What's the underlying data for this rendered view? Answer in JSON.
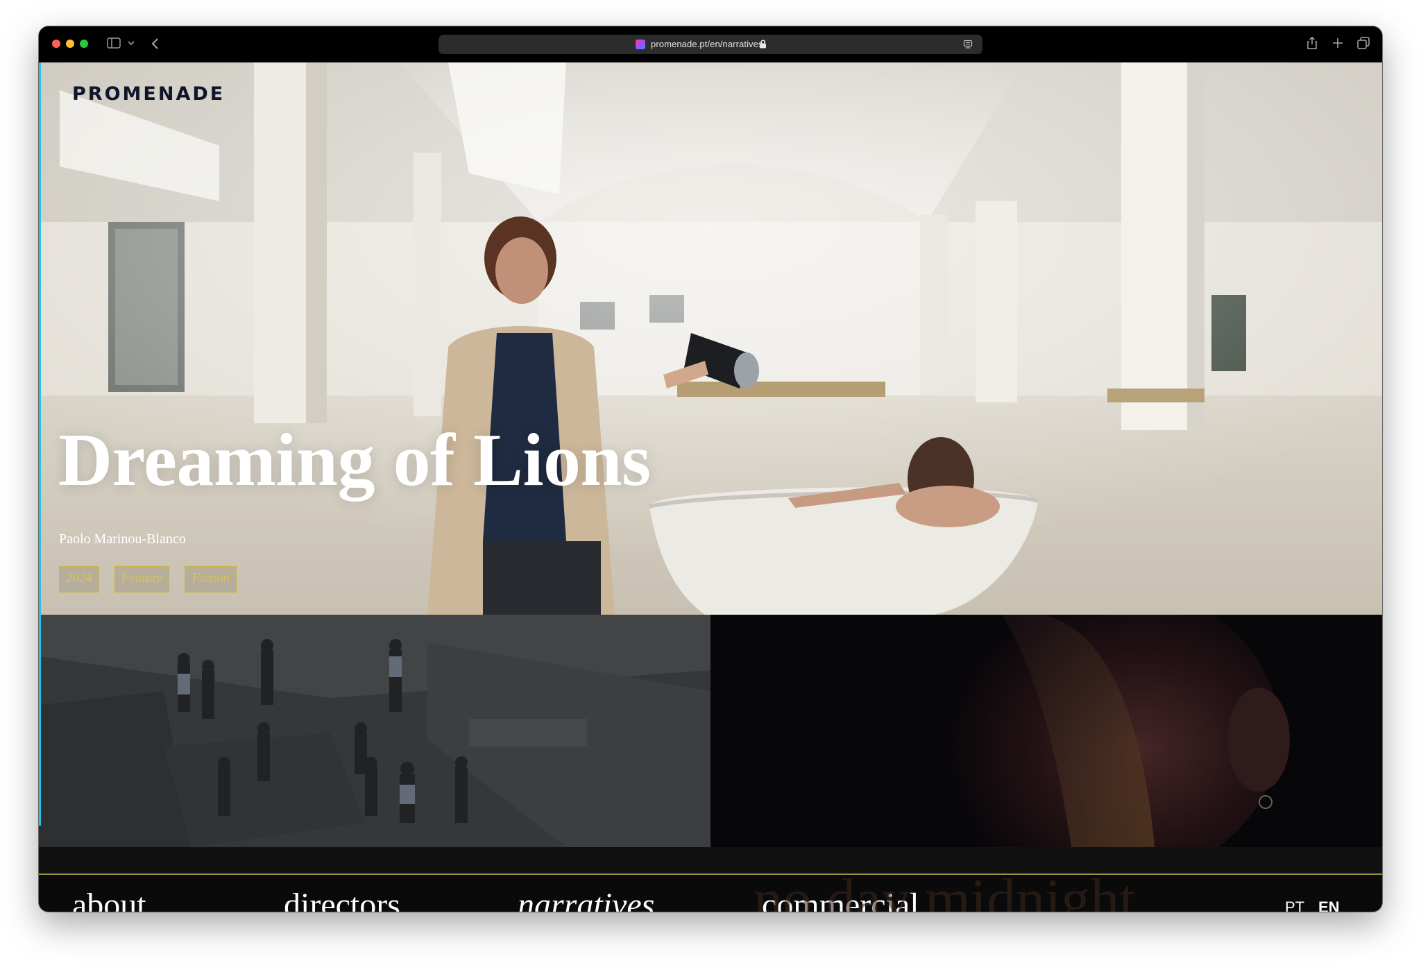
{
  "browser": {
    "url": "promenade.pt/en/narratives/",
    "icons": [
      "sidebar-icon",
      "chevron-down-icon",
      "back-icon",
      "lock-icon",
      "reader-icon",
      "share-icon",
      "plus-icon",
      "tabs-overview-icon"
    ]
  },
  "site": {
    "logo": "PROMENADE"
  },
  "hero": {
    "title": "Dreaming of Lions",
    "director": "Paolo Marinou-Blanco",
    "tags": [
      "2024",
      "Feature",
      "Fiction"
    ]
  },
  "grid": {
    "tile_right_caption": "no day midnight"
  },
  "nav": {
    "items": [
      "about",
      "directors",
      "narratives",
      "commercial"
    ],
    "active": "narratives",
    "languages": [
      "PT",
      "EN"
    ],
    "active_language": "EN"
  },
  "colors": {
    "accent_edge": "#25c3e6",
    "tag_gold": "#c9b24a",
    "nav_rule": "#9b8f3a",
    "logo": "#11152a"
  }
}
